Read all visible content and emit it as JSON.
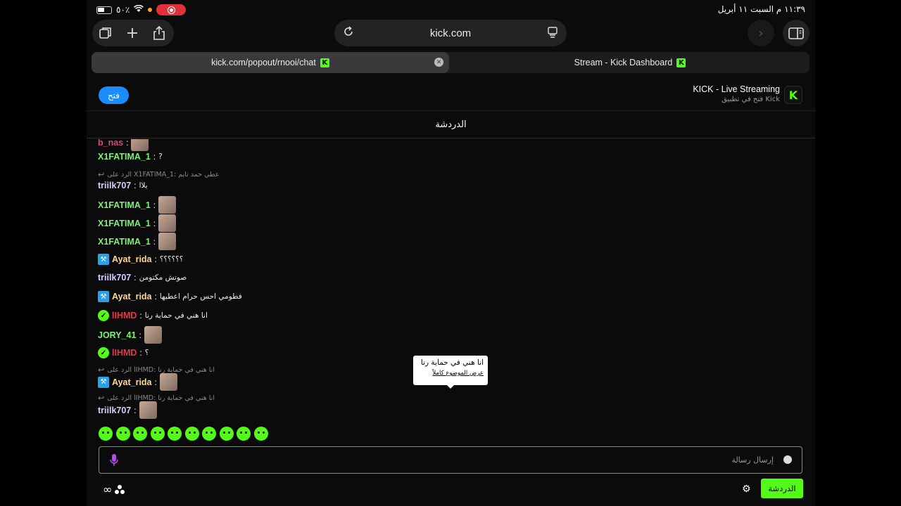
{
  "status_bar": {
    "battery": "٥٠٪",
    "time_date": "١١:٣٩ م   السبت ١١ أبريل"
  },
  "browser": {
    "url": "kick.com",
    "tabs": [
      {
        "label": "kick.com/popout/rnooi/chat",
        "active": true
      },
      {
        "label": "Stream - Kick Dashboard",
        "active": false
      }
    ]
  },
  "banner": {
    "open_label": "فتح",
    "title": "KICK - Live Streaming",
    "subtitle": "فتح في تطبيق Kick",
    "logo_letter": "K"
  },
  "chat": {
    "header": "الدردشة",
    "partial_user": "b_nas",
    "messages": [
      {
        "user": "X1FATIMA_1",
        "text": "?"
      },
      {
        "reply": "الرد على X1FATIMA_1: عطي حمد تايم"
      },
      {
        "user": "triilk707",
        "text": "يلاا"
      },
      {
        "user": "X1FATIMA_1",
        "text": ""
      },
      {
        "user": "X1FATIMA_1",
        "text": ""
      },
      {
        "user": "X1FATIMA_1",
        "text": ""
      },
      {
        "user": "Ayat_rida",
        "text": "؟؟؟؟؟؟"
      },
      {
        "user": "triilk707",
        "text": "صوتش مكتومن"
      },
      {
        "user": "Ayat_rida",
        "text": "فطومي احس حرام اعطيها"
      },
      {
        "user": "lIHMD",
        "text": "انا هني في حماية رنا"
      },
      {
        "user": "JORY_41",
        "text": ""
      },
      {
        "user": "lIHMD",
        "text": "؟"
      },
      {
        "reply": "الرد على lIHMD: انا هني في حماية رنا"
      },
      {
        "user": "Ayat_rida",
        "text": ""
      },
      {
        "reply": "الرد على lIHMD: انا هني في حماية رنا"
      },
      {
        "user": "triilk707",
        "text": ""
      }
    ],
    "tooltip": {
      "text": "انا هني في حماية رنا",
      "link": "عرض الموضوع كاملاً"
    },
    "input_placeholder": "إرسال رسالة",
    "send_label": "الدردشة"
  },
  "colors": {
    "kick_green": "#53fc18",
    "background": "#0b0b0c",
    "open_button": "#1a8cff"
  }
}
